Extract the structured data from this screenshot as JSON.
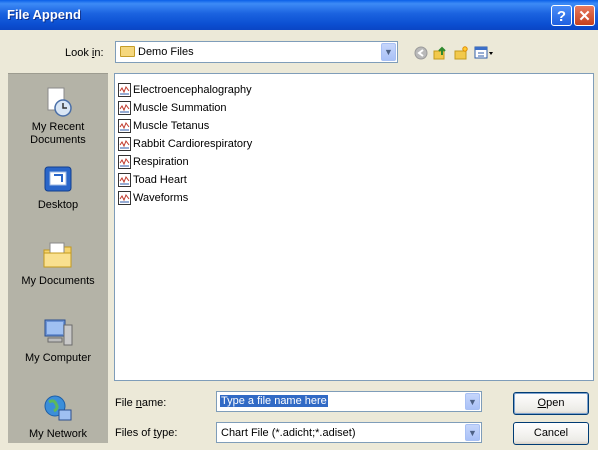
{
  "window": {
    "title": "File Append",
    "help_glyph": "?",
    "close_glyph": "✕"
  },
  "lookin": {
    "label_pre": "Look ",
    "label_key": "i",
    "label_post": "n:",
    "value": "Demo Files"
  },
  "places": [
    {
      "label_lines": [
        "My Recent",
        "Documents"
      ],
      "icon": "recent-documents-icon"
    },
    {
      "label_lines": [
        "Desktop"
      ],
      "icon": "desktop-icon"
    },
    {
      "label_lines": [
        "My Documents"
      ],
      "icon": "my-documents-icon"
    },
    {
      "label_lines": [
        "My Computer"
      ],
      "icon": "my-computer-icon"
    },
    {
      "label_lines": [
        "My Network"
      ],
      "icon": "my-network-icon"
    }
  ],
  "files": [
    "Electroencephalography",
    "Muscle Summation",
    "Muscle Tetanus",
    "Rabbit Cardiorespiratory",
    "Respiration",
    "Toad Heart",
    "Waveforms"
  ],
  "file_name": {
    "label_pre": "File ",
    "label_key": "n",
    "label_post": "ame:",
    "value": "Type a file name here"
  },
  "file_type": {
    "label_pre": "Files of ",
    "label_key": "t",
    "label_post": "ype:",
    "value": "Chart File (*.adicht;*.adiset)"
  },
  "buttons": {
    "open_key": "O",
    "open_rest": "pen",
    "cancel": "Cancel"
  },
  "colors": {
    "titlebar": "#0a4fd2",
    "dialog_bg": "#ECE9D8",
    "places_bg": "#b4b3a7",
    "selection": "#316ac5"
  }
}
